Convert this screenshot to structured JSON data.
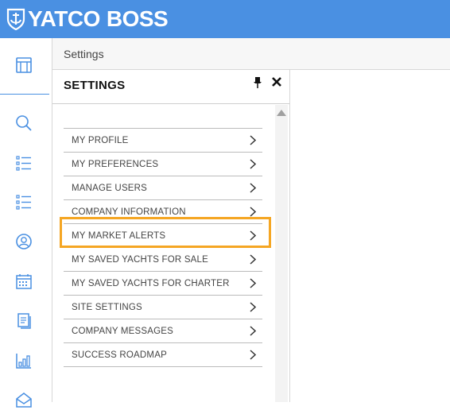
{
  "app": {
    "logo_text_1": "YATCO",
    "logo_text_2": "BOSS"
  },
  "breadcrumb": {
    "label": "Settings"
  },
  "panel": {
    "title": "SETTINGS",
    "items": [
      {
        "label": "MY PROFILE"
      },
      {
        "label": "MY PREFERENCES"
      },
      {
        "label": "MANAGE USERS"
      },
      {
        "label": "COMPANY INFORMATION"
      },
      {
        "label": "MY MARKET ALERTS"
      },
      {
        "label": "MY SAVED YACHTS FOR SALE"
      },
      {
        "label": "MY SAVED YACHTS FOR CHARTER"
      },
      {
        "label": "SITE SETTINGS"
      },
      {
        "label": "COMPANY MESSAGES"
      },
      {
        "label": "SUCCESS ROADMAP"
      }
    ],
    "highlighted_item": "MY MARKET ALERTS"
  },
  "sidebar": {
    "icons": [
      "dashboard-icon",
      "search-icon",
      "list-icon",
      "list-icon",
      "contacts-icon",
      "calendar-icon",
      "documents-icon",
      "reports-icon",
      "mail-icon"
    ]
  },
  "colors": {
    "header": "#4a90e2",
    "highlight": "#f5a623",
    "icon": "#4a90e2"
  }
}
